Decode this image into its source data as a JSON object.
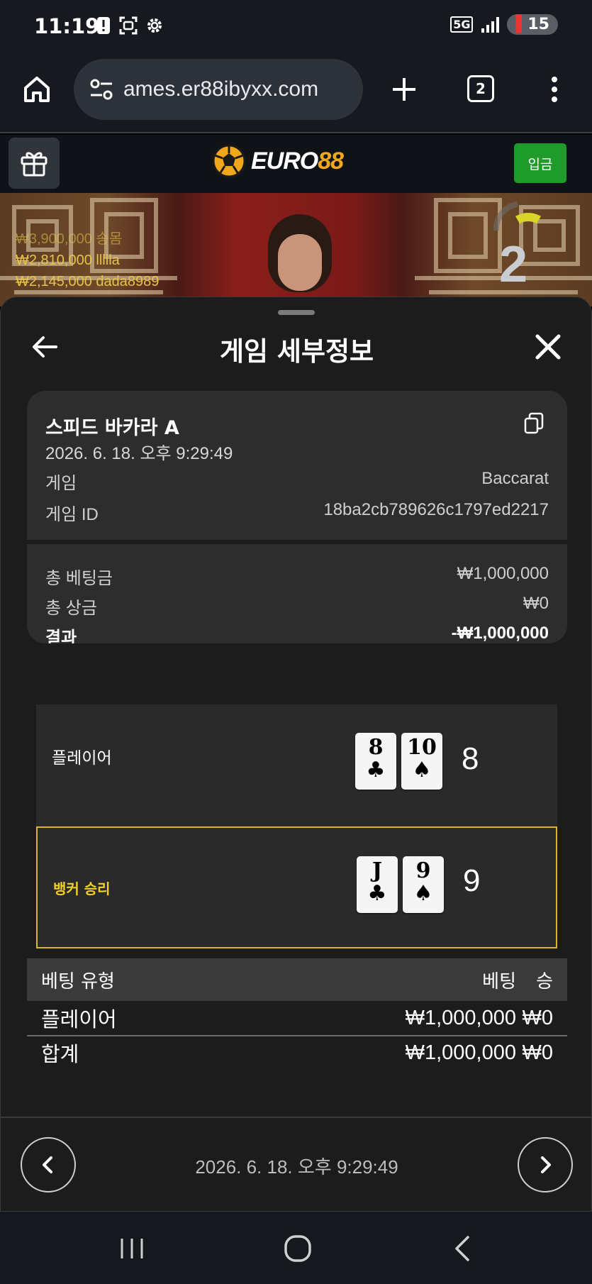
{
  "status_bar": {
    "time": "11:19",
    "network": "5G",
    "battery": "15"
  },
  "browser": {
    "url": "ames.er88ibyxx.com",
    "tab_count": "2"
  },
  "site": {
    "logo_part1": "EURO",
    "logo_part2": "88",
    "deposit_label": "입금"
  },
  "live": {
    "bets": [
      {
        "amount": "₩3,900,000",
        "user": "송몸"
      },
      {
        "amount": "₩2,810,000",
        "user": "llllla"
      },
      {
        "amount": "₩2,145,000",
        "user": "dada8989"
      }
    ],
    "timer": "2"
  },
  "sheet": {
    "title": "게임 세부정보",
    "game_name": "스피드 바카라 A",
    "game_datetime": "2026. 6. 18. 오후 9:29:49",
    "game_label": "게임",
    "game_value": "Baccarat",
    "game_id_label": "게임 ID",
    "game_id_value": "18ba2cb789626c1797ed2217",
    "total_bet_label": "총 베팅금",
    "total_bet_value": "₩1,000,000",
    "total_win_label": "총 상금",
    "total_win_value": "₩0",
    "result_label": "결과",
    "result_value": "-₩1,000,000"
  },
  "hands": {
    "player": {
      "label": "플레이어",
      "cards": [
        {
          "rank": "8",
          "suit": "♣"
        },
        {
          "rank": "10",
          "suit": "♠"
        }
      ],
      "score": "8"
    },
    "banker": {
      "label": "뱅커 승리",
      "cards": [
        {
          "rank": "J",
          "suit": "♣"
        },
        {
          "rank": "9",
          "suit": "♠"
        }
      ],
      "score": "9"
    }
  },
  "bet_table": {
    "headers": {
      "type": "베팅 유형",
      "bet": "베팅",
      "win": "승"
    },
    "rows": [
      {
        "type": "플레이어",
        "bet": "₩1,000,000",
        "win": "₩0"
      }
    ],
    "total": {
      "type": "합계",
      "bet": "₩1,000,000",
      "win": "₩0"
    }
  },
  "footer_nav": {
    "date": "2026. 6. 18. 오후 9:29:49"
  },
  "colors": {
    "accent_gold": "#f0a71b",
    "banker_highlight": "#f3cf2a",
    "deposit_green": "#1f9b2c"
  }
}
